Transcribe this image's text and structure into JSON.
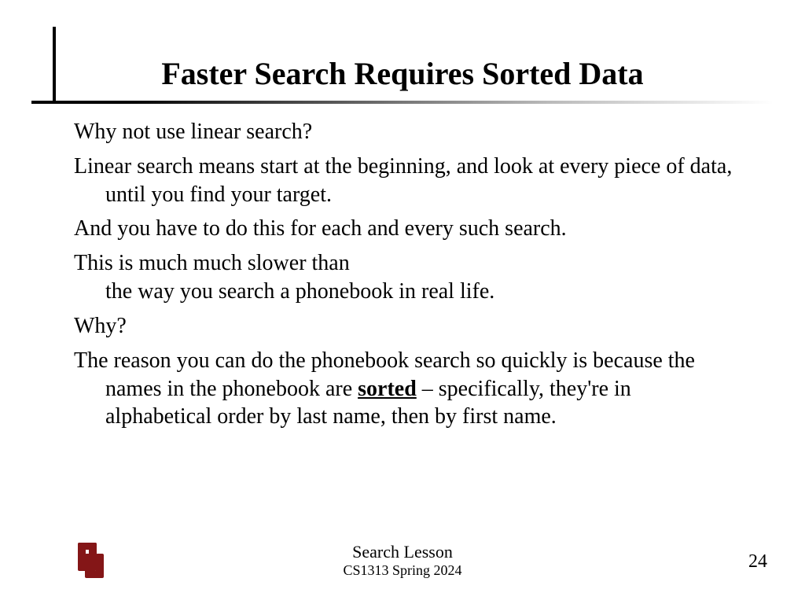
{
  "title": "Faster Search Requires Sorted Data",
  "body": {
    "p1": "Why not use linear search?",
    "p2": "Linear search means start at the beginning, and look at every piece of data, until you find your target.",
    "p3": "And you have to do this for each and every such search.",
    "p4a": "This is much much slower than",
    "p4b": "the way you search a phonebook in real life.",
    "p5": "Why?",
    "p6a": "The reason you can do the phonebook search so quickly is because the names in the phonebook are ",
    "p6b": "sorted",
    "p6c": " – specifically, they're in alphabetical order by last name, then by first name."
  },
  "footer": {
    "line1": "Search Lesson",
    "line2": "CS1313 Spring 2024",
    "page": "24"
  },
  "colors": {
    "crimson": "#841617"
  }
}
